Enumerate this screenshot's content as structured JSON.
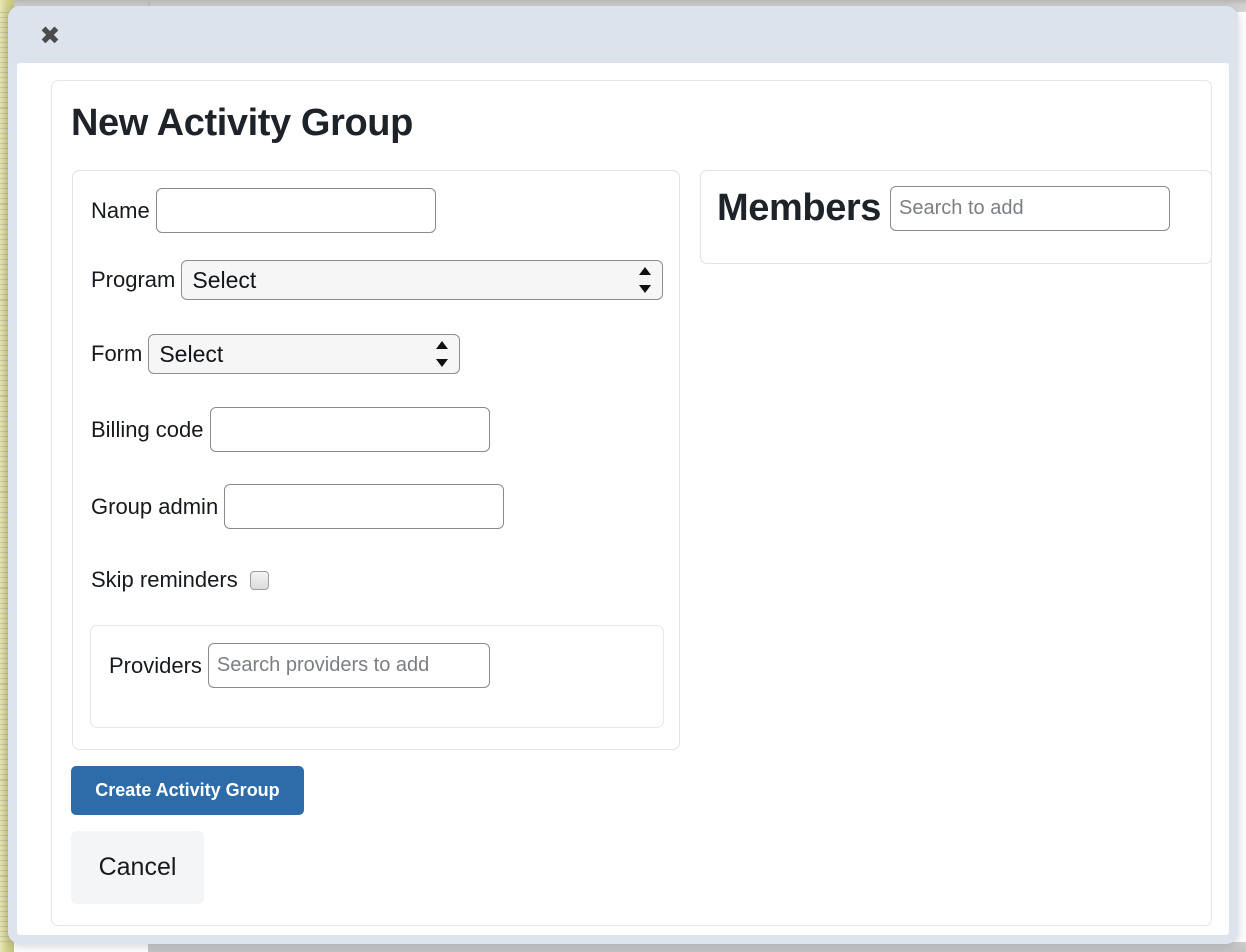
{
  "modal": {
    "close_icon": "close-icon",
    "close_label": "✖",
    "title": "New Activity Group"
  },
  "form": {
    "fields": [
      {
        "label": "Name",
        "type": "text",
        "value": "",
        "placeholder": ""
      },
      {
        "label": "Program",
        "type": "select",
        "value": "Select"
      },
      {
        "label": "Form",
        "type": "select",
        "value": "Select"
      },
      {
        "label": "Billing code",
        "type": "text",
        "value": "",
        "placeholder": ""
      },
      {
        "label": "Group admin",
        "type": "text",
        "value": "",
        "placeholder": ""
      },
      {
        "label": "Skip reminders",
        "type": "checkbox",
        "checked": false
      }
    ],
    "providers": {
      "label": "Providers",
      "placeholder": "Search providers to add",
      "value": ""
    }
  },
  "members": {
    "title": "Members",
    "placeholder": "Search to add",
    "value": ""
  },
  "actions": {
    "submit_label": "Create Activity Group",
    "cancel_label": "Cancel"
  },
  "colors": {
    "primary_button": "#2d6ca8",
    "modal_frame": "#dde3ec",
    "cancel_button": "#f4f5f7",
    "title_text": "#1e2329",
    "page_strip": "#cfce8c"
  }
}
